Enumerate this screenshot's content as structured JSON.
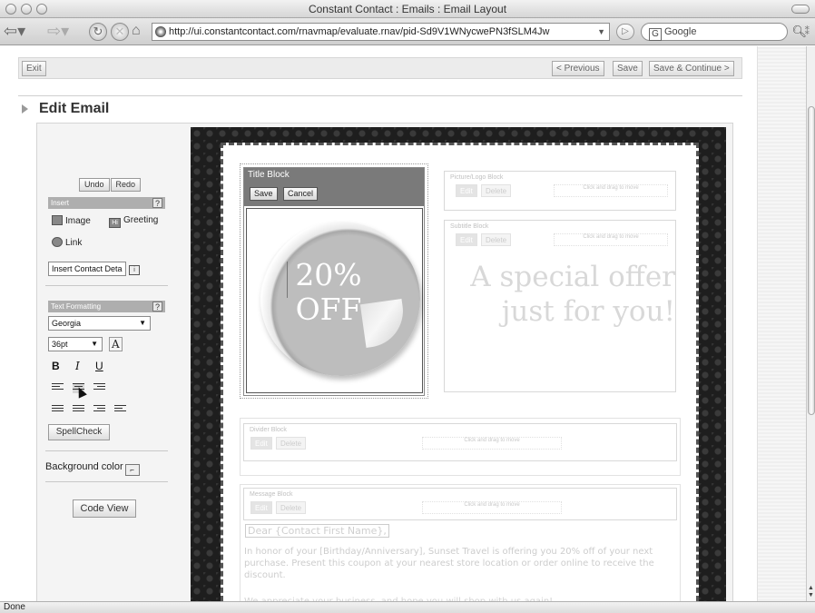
{
  "window": {
    "title": "Constant Contact : Emails : Email Layout"
  },
  "browser": {
    "url": "http://ui.constantcontact.com/rnavmap/evaluate.rnav/pid-Sd9V1WNycwePN3fSLM4Jw",
    "search_placeholder": "Google",
    "status": "Done"
  },
  "actions": {
    "exit": "Exit",
    "previous": "< Previous",
    "save": "Save",
    "save_continue": "Save & Continue >"
  },
  "page": {
    "title": "Edit Email"
  },
  "tools": {
    "undo": "Undo",
    "redo": "Redo",
    "insert_header": "Insert",
    "help": "?",
    "image": "Image",
    "greeting": "Greeting",
    "link": "Link",
    "insert_contact": "Insert Contact Deta",
    "text_formatting_header": "Text Formatting",
    "font": "Georgia",
    "size": "36pt",
    "bold": "B",
    "italic": "I",
    "underline": "U",
    "spellcheck": "SpellCheck",
    "background_color": "Background color",
    "code_view": "Code View"
  },
  "blocks": {
    "title_block": {
      "label": "Title Block",
      "save": "Save",
      "cancel": "Cancel",
      "badge_line1": "20%",
      "badge_line2": "OFF"
    },
    "picture_block": {
      "label": "Picture/Logo Block",
      "edit": "Edit",
      "delete": "Delete",
      "drag": "Click and  drag to move"
    },
    "subtitle_block": {
      "label": "Subtitle Block",
      "edit": "Edit",
      "delete": "Delete",
      "drag": "Click and  drag to move",
      "text": "A special offer just for you!"
    },
    "divider_block": {
      "label": "Divider Block",
      "edit": "Edit",
      "delete": "Delete",
      "drag": "Click and  drag to move"
    },
    "message_block": {
      "label": "Message Block",
      "edit": "Edit",
      "delete": "Delete",
      "drag": "Click and  drag to move",
      "greeting": "Dear {Contact First Name},",
      "body": "In honor of your [Birthday/Anniversary], Sunset Travel is offering you 20% off of your next purchase. Present this coupon at your nearest store location or order online to receive the discount.",
      "body2": "We appreciate your business, and hope you will shop with us again!"
    }
  }
}
